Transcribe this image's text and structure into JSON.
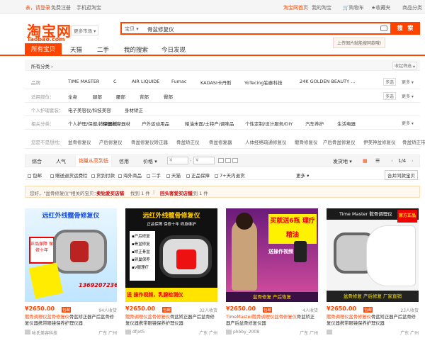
{
  "topbar": {
    "login": "亲，请登录",
    "register": "免费注册",
    "mobile": "手机逛淘宝",
    "home": "淘宝网首页",
    "my": "我的淘宝",
    "cart": "购物车",
    "fav": "收藏夹",
    "category": "商品分类"
  },
  "logo": {
    "name": "淘宝网",
    "sub": "Taobao.com"
  },
  "market": "更多市场 ▾",
  "search": {
    "type": "宝贝 ▾",
    "value": "骨盆修复仪",
    "button": "搜 索",
    "upload_tip": "上传图片就能搜同款哦!"
  },
  "tabs": {
    "all": "所有宝贝",
    "tmall": "天猫",
    "second": "二手",
    "mine": "我的搜索",
    "today": "今日发现"
  },
  "filter": {
    "cat_label": "所有分类 ›",
    "collapse": "收起筛选 ▴",
    "brand_label": "品牌",
    "brands": [
      "TIME MASTER",
      "C",
      "AIR LIQUIDE",
      "Fumac",
      "KADASI卡丹斯",
      "YoTecing铂泰科技",
      "24K GOLDEN BEAUTY ..."
    ],
    "parts_label": "适用部位：",
    "parts": [
      "全身",
      "腿部",
      "腰部",
      "背部",
      "臀部"
    ],
    "care_label": "个人护理套装：",
    "care": [
      "电子美容仪/科技美容",
      "身材矫正"
    ],
    "related_label": "相关分类：",
    "related": [
      "个人护理/保健/按摩器材",
      "保健按摩器材",
      "户外运动用品",
      "粮油米面/土特产/调味品",
      "个性定制/设计服务/DIY",
      "汽车养护",
      "生活电器"
    ],
    "want_label": "您是不是想找：",
    "want": [
      "盆骨修复仪",
      "产后修复仪",
      "骨盆修复仪矫正器",
      "骨盆矫正仪",
      "骨盆修复器",
      "人体经络疏通修复仪",
      "髋骨修复仪",
      "产后骨盆修复仪",
      "伊美神盆修复仪",
      "骨盆矫正带"
    ],
    "multi": "多选",
    "more": "更多 ▾"
  },
  "sort": {
    "comprehensive": "综合",
    "popularity": "人气",
    "sales": "销量从高到低",
    "credit": "信用",
    "price": "价格 ▾",
    "from": "¥",
    "to": "¥",
    "ship": "发货地 ▾",
    "page": "1/4"
  },
  "checks": [
    "包邮",
    "赠送退货运费险",
    "货到付款",
    "海外商品",
    "二手",
    "天猫",
    "正品保障",
    "7+天内退货"
  ],
  "check_more": "更多 ▾",
  "merge": "合并同款宝贝",
  "notice": {
    "prefix": "您好，\"盆骨修复仪\"相关的宝贝：",
    "a": "卖钻爱买店铺",
    "ca": " 找到 1 件",
    "sep": " | ",
    "b": "回头客爱买店铺",
    "cb": " 找到 1 件"
  },
  "cards": [
    {
      "img_title": "远红外线髋骨修复仪",
      "sub": "正品保障 保修十年",
      "phone": "13692072366",
      "price": "¥2650.00",
      "sold": "94人收货",
      "title1": "髋骨调理仪盆骨修复仪",
      "title2": "骨盆矫正器产后盆骨修复仪器携带眼镜保养护理仪器",
      "shop": "咏氏美容科技",
      "loc": "广东 广州"
    },
    {
      "img_title": "远红外线髋骨修复仪",
      "sub": "正品保障 保修十年 终身维护",
      "phone": "送 操作视频，乳腺检测仪",
      "price": "¥2650.00",
      "sold": "32人收货",
      "title1": "髋骨调理仪盆骨修复仪",
      "title2": "骨盆矫正器产后盆骨修复仪器携带眼镜保养护理仪器",
      "shop": "dfjxt5",
      "loc": "广东 广州"
    },
    {
      "img_title": "买就送6瓶 理疗精油",
      "sub": "送操作视频",
      "phone": "盆骨修复 产后恢复",
      "price": "¥2650.00",
      "sold": "4人收货",
      "title1": "TimeMaster髋骨调理仪盆骨修复仪",
      "title2": "骨盆矫正器产后盆骨修复仪器",
      "shop": "phbby_2008",
      "loc": "广东 广州"
    },
    {
      "img_title": "Time Master 髋骨调理仪",
      "sub": "官方正品",
      "phone": "盆骨修复 产后修复 厂家直销",
      "price": "¥2650.00",
      "sold": "23人收货",
      "title1": "髋骨调理仪盆骨修复仪",
      "title2": "骨盆矫正器产后盆骨修复仪器携带眼镜保养护理仪器",
      "shop": "",
      "loc": "广东 广州"
    }
  ],
  "colors": {
    "accent": "#ff4400"
  }
}
